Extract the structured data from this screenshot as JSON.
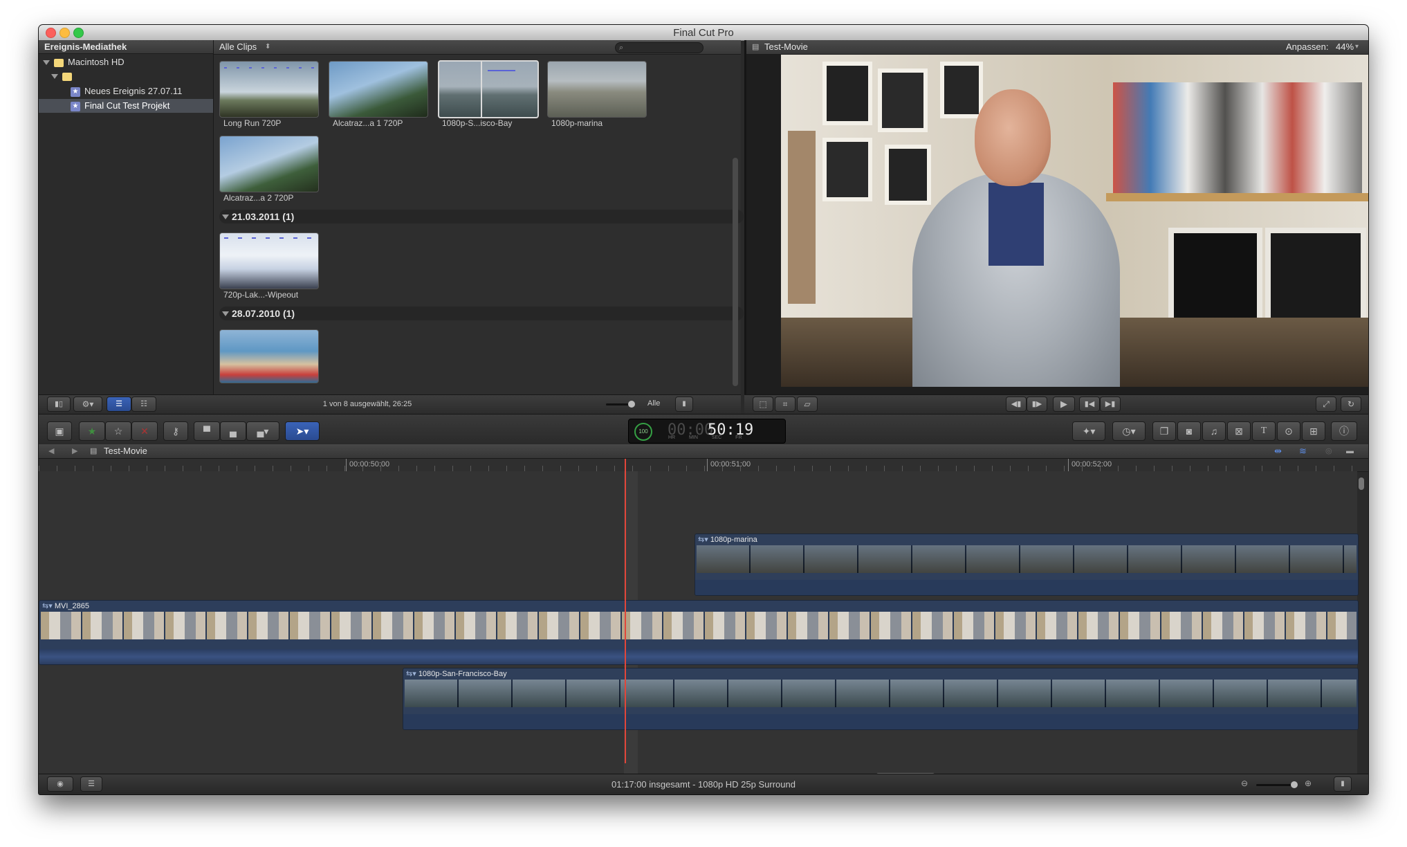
{
  "window": {
    "title": "Final Cut Pro"
  },
  "library": {
    "header": "Ereignis-Mediathek",
    "items": [
      {
        "label": "Macintosh HD"
      },
      {
        "label": "Neues Ereignis 27.07.11"
      },
      {
        "label": "Final Cut Test Projekt"
      }
    ]
  },
  "browser": {
    "filter": "Alle Clips",
    "search_placeholder": "",
    "clips_top": [
      "Long Run 720P",
      "Alcatraz...a 1 720P",
      "1080p-S...isco-Bay",
      "1080p-marina",
      "Alcatraz...a 2 720P"
    ],
    "groups": [
      {
        "date": "21.03.2011",
        "count": "(1)",
        "clips": [
          "720p-Lak...-Wipeout"
        ]
      },
      {
        "date": "28.07.2010",
        "count": "(1)",
        "clips": []
      }
    ],
    "status": "1 von 8 ausgewählt, 26:25",
    "filter_short": "Alle"
  },
  "viewer": {
    "title": "Test-Movie",
    "fit_label": "Anpassen:",
    "zoom": "44%"
  },
  "timecode": {
    "dim": "00:00",
    "value": "50:19",
    "units": "HR MIN SEC FR",
    "ring": "100"
  },
  "timeline": {
    "title": "Test-Movie",
    "ruler": [
      "00:00:50:00",
      "00:00:51:00",
      "00:00:52:00"
    ],
    "clips": {
      "top": "1080p-marina",
      "main": "MVI_2865",
      "bottom": "1080p-San-Francisco-Bay"
    }
  },
  "status": {
    "summary": "01:17:00 insgesamt - 1080p HD 25p Surround"
  }
}
